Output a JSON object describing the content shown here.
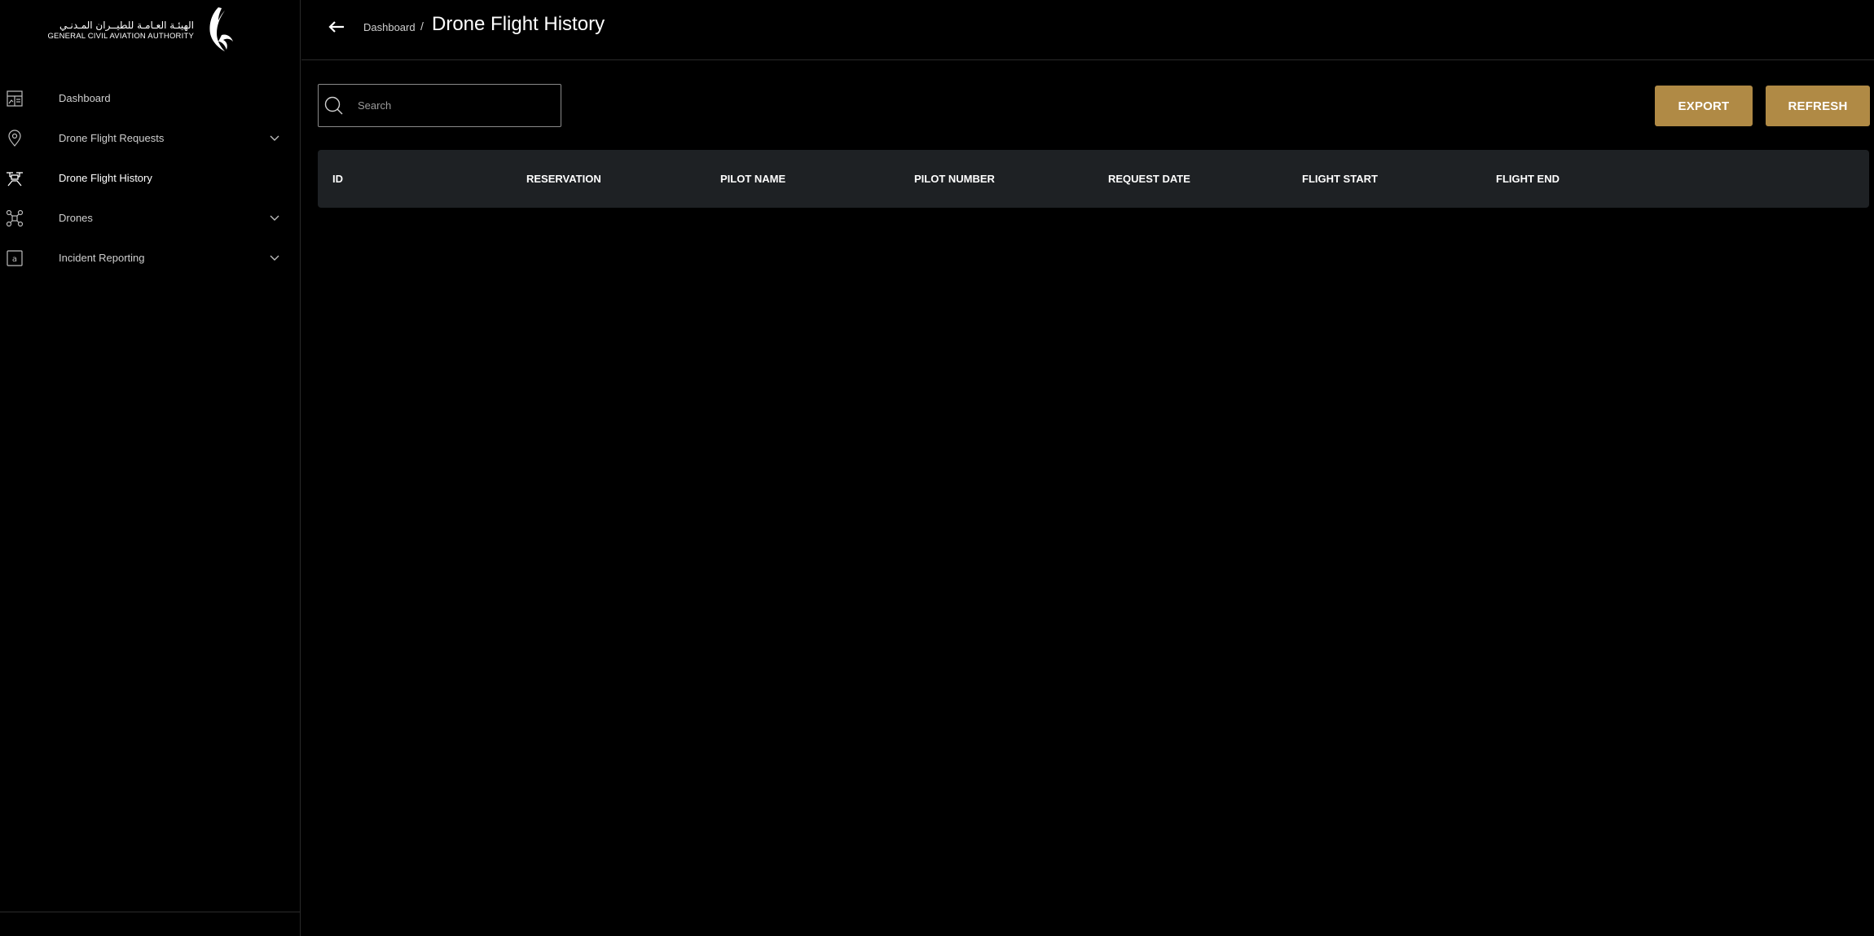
{
  "brand": {
    "arabic": "الهيئـة العـامـة للطيــران المـدنـي",
    "english": "GENERAL CIVIL AVIATION AUTHORITY",
    "logo_icon": "falcon-wing-logo"
  },
  "sidebar": {
    "items": [
      {
        "label": "Dashboard",
        "icon": "dashboard-icon",
        "expandable": false,
        "active": false
      },
      {
        "label": "Drone Flight Requests",
        "icon": "location-pin-icon",
        "expandable": true,
        "active": false
      },
      {
        "label": "Drone Flight History",
        "icon": "drone-history-icon",
        "expandable": false,
        "active": true
      },
      {
        "label": "Drones",
        "icon": "drone-icon",
        "expandable": true,
        "active": false
      },
      {
        "label": "Incident Reporting",
        "icon": "incident-icon",
        "expandable": true,
        "active": false
      }
    ]
  },
  "header": {
    "breadcrumb": "Dashboard",
    "separator": "/",
    "title": "Drone Flight History"
  },
  "search": {
    "placeholder": "Search",
    "value": ""
  },
  "actions": {
    "export_label": "EXPORT",
    "refresh_label": "REFRESH"
  },
  "table": {
    "columns": [
      "ID",
      "RESERVATION",
      "PILOT NAME",
      "PILOT NUMBER",
      "REQUEST DATE",
      "FLIGHT START",
      "FLIGHT END"
    ],
    "rows": []
  },
  "colors": {
    "background": "#000000",
    "accent": "#b08a45",
    "table_header": "#1e2124",
    "divider": "#2a2a2a"
  }
}
